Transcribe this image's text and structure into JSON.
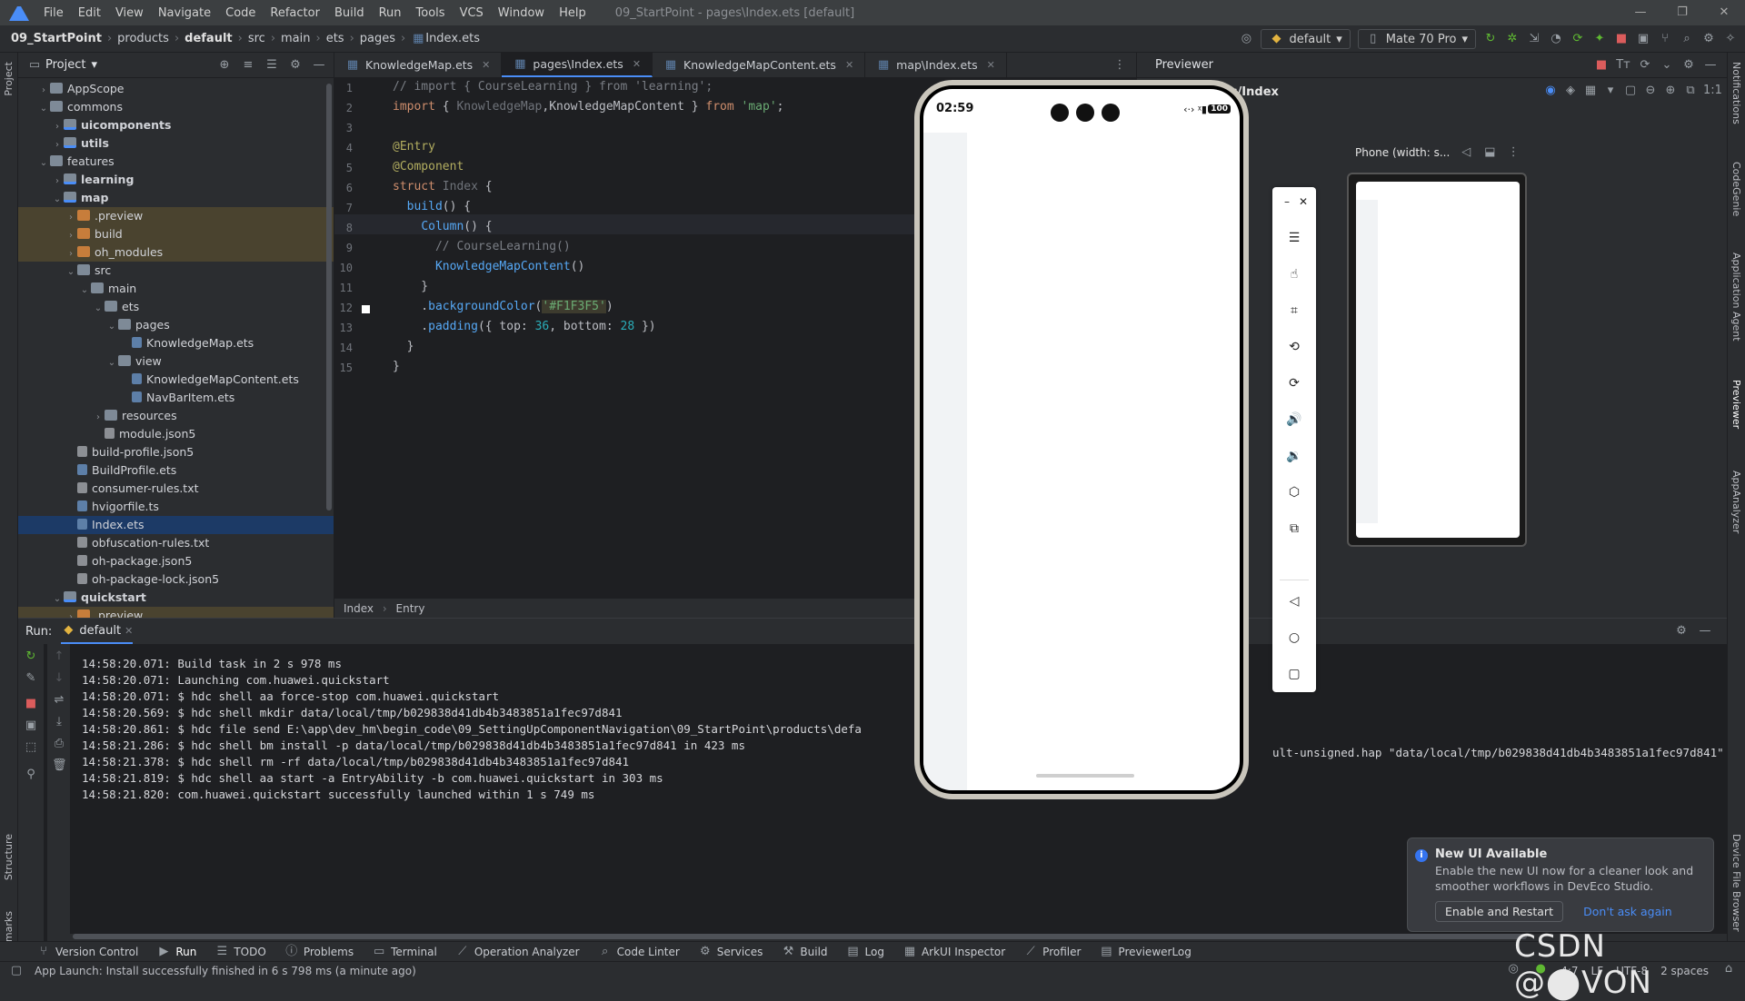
{
  "menubar": {
    "items": [
      "File",
      "Edit",
      "View",
      "Navigate",
      "Code",
      "Refactor",
      "Build",
      "Run",
      "Tools",
      "VCS",
      "Window",
      "Help"
    ],
    "title": "09_StartPoint - pages\\Index.ets [default]"
  },
  "navbar": {
    "crumbs": [
      "09_StartPoint",
      "products",
      "default",
      "src",
      "main",
      "ets",
      "pages",
      "Index.ets"
    ],
    "run_config": "default",
    "device": "Mate 70 Pro"
  },
  "project_panel": {
    "title": "Project",
    "tree": [
      {
        "label": "AppScope",
        "indent": 1,
        "arrow": "›",
        "icon": "folder"
      },
      {
        "label": "commons",
        "indent": 1,
        "arrow": "⌄",
        "icon": "folder"
      },
      {
        "label": "uicomponents",
        "indent": 2,
        "arrow": "›",
        "icon": "module",
        "bold": true
      },
      {
        "label": "utils",
        "indent": 2,
        "arrow": "›",
        "icon": "module",
        "bold": true
      },
      {
        "label": "features",
        "indent": 1,
        "arrow": "⌄",
        "icon": "folder"
      },
      {
        "label": "learning",
        "indent": 2,
        "arrow": "›",
        "icon": "module",
        "bold": true
      },
      {
        "label": "map",
        "indent": 2,
        "arrow": "⌄",
        "icon": "module",
        "bold": true
      },
      {
        "label": ".preview",
        "indent": 3,
        "arrow": "›",
        "icon": "folder or",
        "hl": true
      },
      {
        "label": "build",
        "indent": 3,
        "arrow": "›",
        "icon": "folder or",
        "hl": true
      },
      {
        "label": "oh_modules",
        "indent": 3,
        "arrow": "›",
        "icon": "folder or",
        "hl": true
      },
      {
        "label": "src",
        "indent": 3,
        "arrow": "⌄",
        "icon": "folder"
      },
      {
        "label": "main",
        "indent": 4,
        "arrow": "⌄",
        "icon": "folder"
      },
      {
        "label": "ets",
        "indent": 5,
        "arrow": "⌄",
        "icon": "folder"
      },
      {
        "label": "pages",
        "indent": 6,
        "arrow": "⌄",
        "icon": "folder"
      },
      {
        "label": "KnowledgeMap.ets",
        "indent": 7,
        "arrow": "",
        "icon": "file"
      },
      {
        "label": "view",
        "indent": 6,
        "arrow": "⌄",
        "icon": "folder"
      },
      {
        "label": "KnowledgeMapContent.ets",
        "indent": 7,
        "arrow": "",
        "icon": "file"
      },
      {
        "label": "NavBarItem.ets",
        "indent": 7,
        "arrow": "",
        "icon": "file"
      },
      {
        "label": "resources",
        "indent": 5,
        "arrow": "›",
        "icon": "folder"
      },
      {
        "label": "module.json5",
        "indent": 5,
        "arrow": "",
        "icon": "json"
      },
      {
        "label": "build-profile.json5",
        "indent": 3,
        "arrow": "",
        "icon": "json"
      },
      {
        "label": "BuildProfile.ets",
        "indent": 3,
        "arrow": "",
        "icon": "file"
      },
      {
        "label": "consumer-rules.txt",
        "indent": 3,
        "arrow": "",
        "icon": "json"
      },
      {
        "label": "hvigorfile.ts",
        "indent": 3,
        "arrow": "",
        "icon": "file"
      },
      {
        "label": "Index.ets",
        "indent": 3,
        "arrow": "",
        "icon": "file",
        "sel": true
      },
      {
        "label": "obfuscation-rules.txt",
        "indent": 3,
        "arrow": "",
        "icon": "json"
      },
      {
        "label": "oh-package.json5",
        "indent": 3,
        "arrow": "",
        "icon": "json"
      },
      {
        "label": "oh-package-lock.json5",
        "indent": 3,
        "arrow": "",
        "icon": "json"
      },
      {
        "label": "quickstart",
        "indent": 2,
        "arrow": "⌄",
        "icon": "module",
        "bold": true
      },
      {
        "label": ".preview",
        "indent": 3,
        "arrow": "›",
        "icon": "folder or",
        "hl": true
      }
    ]
  },
  "editor": {
    "tabs": [
      {
        "label": "KnowledgeMap.ets",
        "active": false
      },
      {
        "label": "pages\\Index.ets",
        "active": true
      },
      {
        "label": "KnowledgeMapContent.ets",
        "active": false
      },
      {
        "label": "map\\Index.ets",
        "active": false
      }
    ],
    "breadcrumb": [
      "Index",
      "Entry"
    ],
    "line_numbers": [
      "1",
      "2",
      "3",
      "4",
      "5",
      "6",
      "7",
      "8",
      "9",
      "10",
      "11",
      "12",
      "13",
      "14",
      "15"
    ]
  },
  "previewer": {
    "title": "Previewer",
    "path_fragment": "es/Index",
    "device_label": "Phone (width: s...",
    "status_time": "02:59",
    "battery": "100"
  },
  "run_panel": {
    "label": "Run:",
    "config_tab": "default",
    "log": [
      "14:58:20.071: Build task in 2 s 978 ms",
      "14:58:20.071: Launching com.huawei.quickstart",
      "14:58:20.071: $ hdc shell aa force-stop com.huawei.quickstart",
      "14:58:20.569: $ hdc shell mkdir data/local/tmp/b029838d41db4b3483851a1fec97d841",
      "14:58:20.861: $ hdc file send E:\\app\\dev_hm\\begin_code\\09_SettingUpComponentNavigation\\09_StartPoint\\products\\defa",
      "14:58:21.286: $ hdc shell bm install -p data/local/tmp/b029838d41db4b3483851a1fec97d841 in 423 ms",
      "14:58:21.378: $ hdc shell rm -rf data/local/tmp/b029838d41db4b3483851a1fec97d841",
      "14:58:21.819: $ hdc shell aa start -a EntryAbility -b com.huawei.quickstart in 303 ms",
      "14:58:21.820: com.huawei.quickstart successfully launched within 1 s 749 ms"
    ],
    "log_tail": "ult-unsigned.hap \"data/local/tmp/b029838d41db4b3483851a1fec97d841\""
  },
  "tool_windows": [
    "Version Control",
    "Run",
    "TODO",
    "Problems",
    "Terminal",
    "Operation Analyzer",
    "Code Linter",
    "Services",
    "Build",
    "Log",
    "ArkUI Inspector",
    "Profiler",
    "PreviewerLog"
  ],
  "status": {
    "message": "App Launch: Install successfully finished in 6 s 798 ms (a minute ago)",
    "position": "4:7",
    "line_sep": "LF",
    "encoding": "UTF-8",
    "indent": "2 spaces"
  },
  "notification": {
    "title": "New UI Available",
    "body": "Enable the new UI now for a cleaner look and smoother workflows in DevEco Studio.",
    "primary": "Enable and Restart",
    "secondary": "Don't ask again"
  },
  "side_labels": {
    "left": [
      "Project",
      "Structure",
      "Bookmarks"
    ],
    "right": [
      "Notifications",
      "CodeGenie",
      "Application Agent",
      "Previewer",
      "AppAnalyzer",
      "Device File Browser"
    ]
  },
  "watermark": "CSDN @⬤VON",
  "colors": {
    "accent": "#4a8df7",
    "selection": "#1c3a66",
    "editor_bg": "#1e1f22",
    "panel_bg": "#2b2d30"
  }
}
